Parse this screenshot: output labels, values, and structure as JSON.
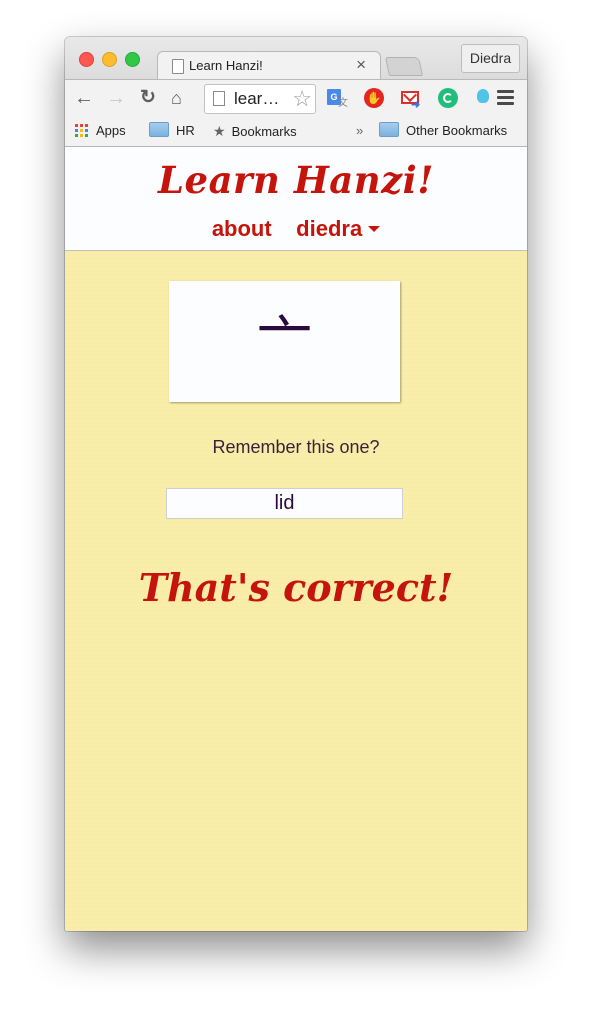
{
  "browser": {
    "tab": {
      "title": "Learn Hanzi!",
      "close_glyph": "×",
      "icon": "page-icon"
    },
    "profile_button": "Diedra",
    "toolbar": {
      "back_glyph": "←",
      "forward_glyph": "→",
      "reload_glyph": "↻",
      "home_glyph": "⌂",
      "omnibox_text": "lear…",
      "bookmark_star_glyph": "☆",
      "extensions": [
        "google-translate-icon",
        "adblock-icon",
        "gmail-checker-icon",
        "grammarly-icon",
        "lamp-icon"
      ]
    },
    "bookmarks": {
      "apps": "Apps",
      "hr": "HR",
      "bookmarks": "Bookmarks",
      "star_glyph": "★",
      "overflow": "»",
      "other": "Other Bookmarks"
    }
  },
  "site": {
    "title": "Learn Hanzi!",
    "nav": {
      "about": "about",
      "user": "diedra"
    },
    "flashcard": {
      "character": "亠"
    },
    "prompt": "Remember this one?",
    "answer_value": "lid",
    "result": "That's correct!"
  },
  "colors": {
    "brand_red": "#c4140c",
    "page_background": "#f8eca6",
    "character_color": "#2b0a3d"
  }
}
